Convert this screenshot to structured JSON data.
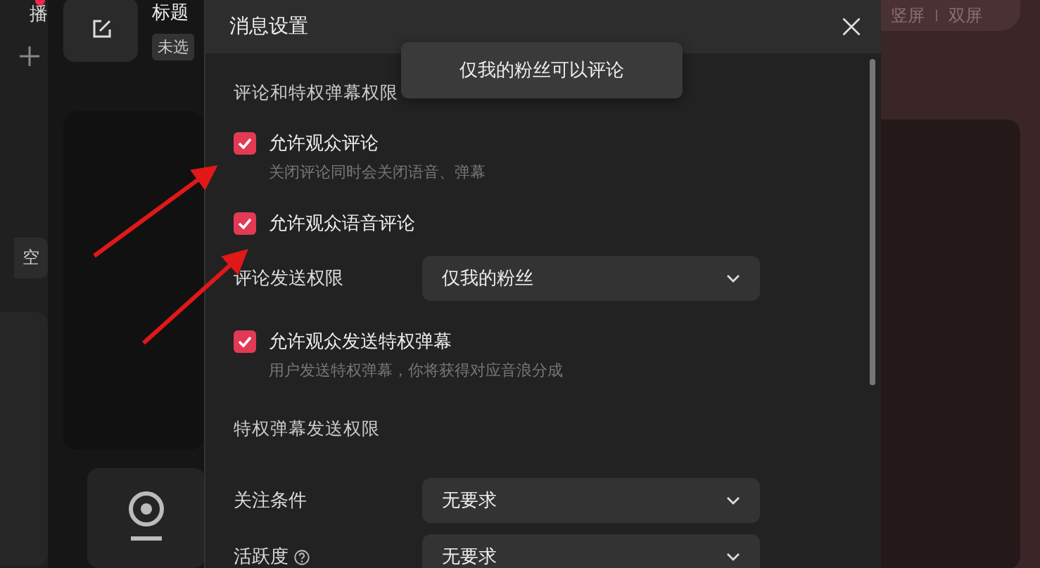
{
  "sidebar": {
    "live_label": "播",
    "live_dot": true,
    "clear_button": "空"
  },
  "stream_card": {
    "title": "标题",
    "category_tag": "未选"
  },
  "layout_switch": [
    "竖屏",
    "双屏"
  ],
  "dialog": {
    "title": "消息设置",
    "sections": [
      {
        "heading": "评论和特权弹幕权限",
        "items": [
          {
            "kind": "checkbox",
            "label": "允许观众评论",
            "checked": true,
            "hint": "关闭评论同时会关闭语音、弹幕"
          },
          {
            "kind": "checkbox",
            "label": "允许观众语音评论",
            "checked": true
          },
          {
            "kind": "select",
            "label": "评论发送权限",
            "value": "仅我的粉丝"
          },
          {
            "kind": "checkbox",
            "label": "允许观众发送特权弹幕",
            "checked": true,
            "hint": "用户发送特权弹幕，你将获得对应音浪分成"
          }
        ]
      },
      {
        "heading": "特权弹幕发送权限",
        "items": [
          {
            "kind": "select",
            "label": "关注条件",
            "value": "无要求"
          },
          {
            "kind": "select",
            "label": "活跃度",
            "value": "无要求",
            "help": true
          }
        ]
      }
    ]
  },
  "toast": "仅我的粉丝可以评论"
}
